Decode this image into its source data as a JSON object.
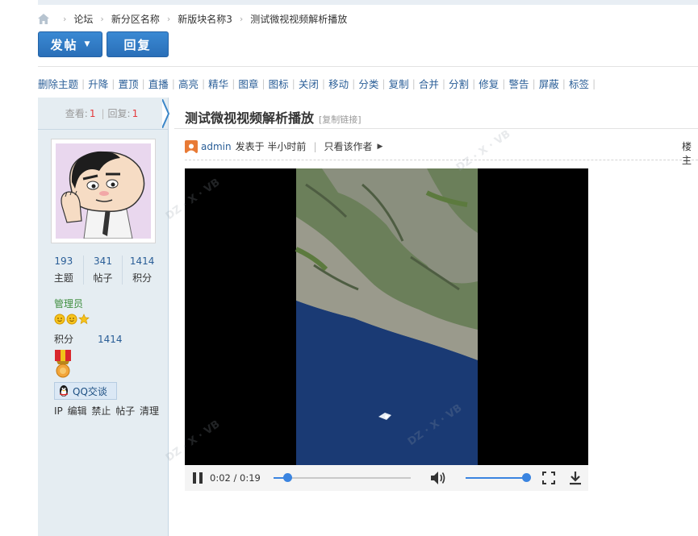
{
  "breadcrumb": {
    "items": [
      "论坛",
      "新分区名称",
      "新版块名称3",
      "测试微视视频解析播放"
    ]
  },
  "buttons": {
    "post_label": "发帖",
    "reply_label": "回复"
  },
  "mod_actions": [
    "删除主题",
    "升降",
    "置顶",
    "直播",
    "高亮",
    "精华",
    "图章",
    "图标",
    "关闭",
    "移动",
    "分类",
    "复制",
    "合并",
    "分割",
    "修复",
    "警告",
    "屏蔽",
    "标签"
  ],
  "sidebar": {
    "views_label": "查看:",
    "views": "1",
    "replies_label": "回复:",
    "replies": "1",
    "user_stats": [
      {
        "value": "193",
        "label": "主题"
      },
      {
        "value": "341",
        "label": "帖子"
      },
      {
        "value": "1414",
        "label": "积分"
      }
    ],
    "role": "管理员",
    "points_label": "积分",
    "points_value": "1414",
    "qq_label": "QQ交谈",
    "admin_links": "IP 编辑 禁止 帖子 清理"
  },
  "post": {
    "title": "测试微视视频解析播放",
    "copy_link": "[复制链接]",
    "author": "admin",
    "posted": "发表于 半小时前",
    "only_author": "只看该作者",
    "floor": "楼主"
  },
  "video": {
    "current_time": "0:02",
    "duration": "0:19",
    "time_display": "0:02 / 0:19",
    "progress": 0.105,
    "volume": 1.0
  },
  "colors": {
    "primary_button": "#2a6fb8",
    "link": "#2a5e97",
    "accent_red": "#e4393c",
    "progress": "#3a84e0",
    "sidebar_bg": "#e5edf2"
  }
}
